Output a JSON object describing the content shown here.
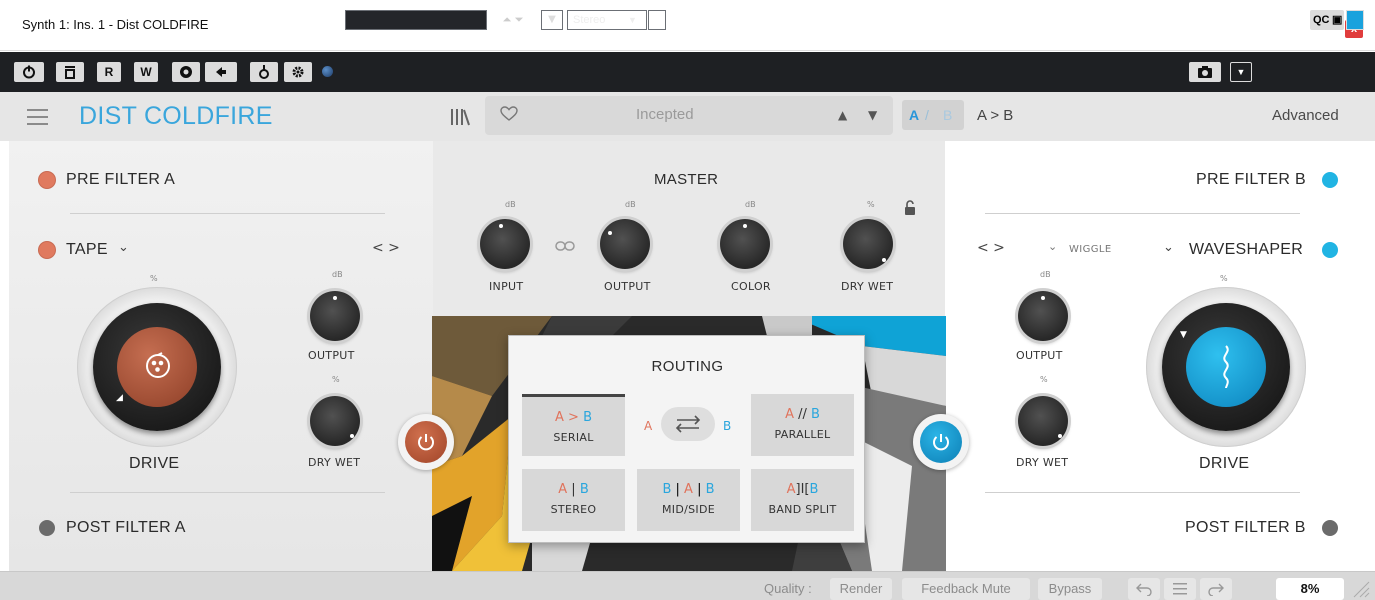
{
  "window": {
    "title": "Synth 1: Ins. 1 - Dist COLDFIRE",
    "close": "x"
  },
  "host_toolbar": {
    "read_label": "R",
    "write_label": "W",
    "stereo_select": "Stereo",
    "dropdown_arrow": "▼",
    "up_down_arrows": "⏶ ⏷",
    "qc_label": "QC"
  },
  "header": {
    "plugin_name": "DIST COLDFIRE",
    "preset_name": "Incepted",
    "prev_arrow": "▲",
    "next_arrow": "▼",
    "ab_a": "A",
    "ab_slash": "/",
    "ab_b": "B",
    "a_to_b": "A > B",
    "advanced": "Advanced"
  },
  "left_panel": {
    "pre_filter": "PRE FILTER A",
    "type": "TAPE",
    "drive_label": "DRIVE",
    "output_label": "OUTPUT",
    "drywet_label": "DRY WET",
    "post_filter": "POST FILTER A",
    "unit_pct": "%",
    "unit_db": "dB",
    "nav": "< >"
  },
  "right_panel": {
    "pre_filter": "PRE FILTER B",
    "type": "WAVESHAPER",
    "mode": "WIGGLE",
    "drive_label": "DRIVE",
    "output_label": "OUTPUT",
    "drywet_label": "DRY WET",
    "post_filter": "POST FILTER B",
    "unit_pct": "%",
    "unit_db": "dB",
    "nav": "< >"
  },
  "master": {
    "title": "MASTER",
    "input_label": "INPUT",
    "output_label": "OUTPUT",
    "color_label": "COLOR",
    "drywet_label": "DRY WET",
    "unit_db": "dB",
    "unit_pct": "%"
  },
  "routing": {
    "title": "ROUTING",
    "serial": {
      "a": "A",
      "sym": ">",
      "b": "B",
      "label": "SERIAL"
    },
    "parallel": {
      "a": "A",
      "sym": "//",
      "b": "B",
      "label": "PARALLEL"
    },
    "stereo": {
      "a": "A",
      "sym": "|",
      "b": "B",
      "label": "STEREO"
    },
    "midside": {
      "b1": "B",
      "a": "A",
      "b2": "B",
      "label": "MID/SIDE"
    },
    "bandsplit": {
      "a": "A",
      "sym": "]I[",
      "b": "B",
      "label": "BAND SPLIT"
    },
    "swap_a": "A",
    "swap_b": "B"
  },
  "status": {
    "quality_label": "Quality :",
    "render": "Render",
    "feedback_mute": "Feedback Mute",
    "bypass": "Bypass",
    "cpu": "8%"
  },
  "colors": {
    "accent_blue": "#3aa6dc",
    "a_color": "#e0735c",
    "b_color": "#2aa6dd"
  }
}
